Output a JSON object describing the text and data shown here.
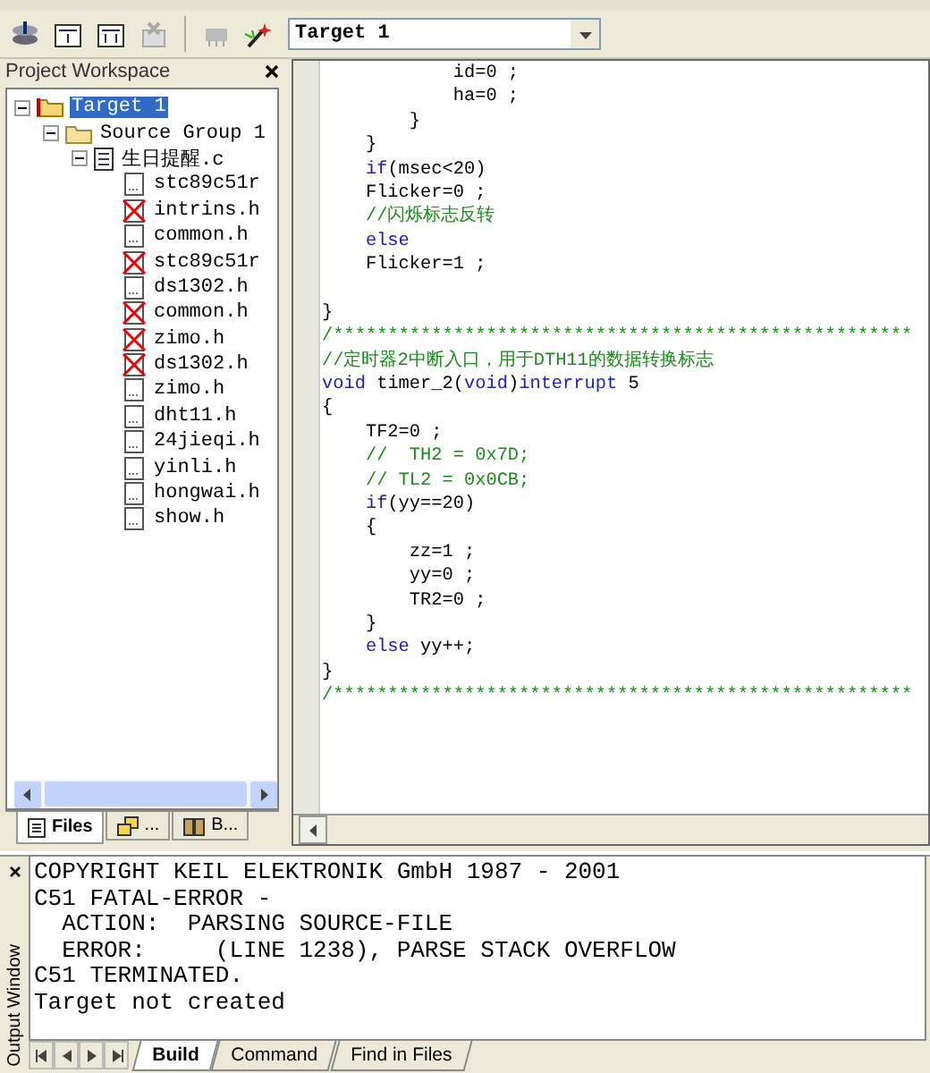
{
  "toolbar": {
    "target_select": {
      "value": "Target 1"
    }
  },
  "workspace": {
    "title": "Project Workspace",
    "tree": [
      {
        "label": "Target 1",
        "kind": "target",
        "selected": true,
        "expanded": true,
        "children": [
          {
            "label": "Source Group 1",
            "kind": "group",
            "selected": false,
            "expanded": true,
            "children": [
              {
                "label": "生日提醒.c",
                "kind": "source",
                "selected": false,
                "expanded": true,
                "children": [
                  {
                    "label": "stc89c51r",
                    "kind": "header",
                    "missing": false,
                    "selected": false
                  },
                  {
                    "label": "intrins.h",
                    "kind": "header",
                    "missing": true,
                    "selected": false
                  },
                  {
                    "label": "common.h",
                    "kind": "header",
                    "missing": false,
                    "selected": false
                  },
                  {
                    "label": "stc89c51r",
                    "kind": "header",
                    "missing": true,
                    "selected": false
                  },
                  {
                    "label": "ds1302.h",
                    "kind": "header",
                    "missing": false,
                    "selected": false
                  },
                  {
                    "label": "common.h",
                    "kind": "header",
                    "missing": true,
                    "selected": false
                  },
                  {
                    "label": "zimo.h",
                    "kind": "header",
                    "missing": true,
                    "selected": false
                  },
                  {
                    "label": "ds1302.h",
                    "kind": "header",
                    "missing": true,
                    "selected": false
                  },
                  {
                    "label": "zimo.h",
                    "kind": "header",
                    "missing": false,
                    "selected": false
                  },
                  {
                    "label": "dht11.h",
                    "kind": "header",
                    "missing": false,
                    "selected": false
                  },
                  {
                    "label": "24jieqi.h",
                    "kind": "header",
                    "missing": false,
                    "selected": false
                  },
                  {
                    "label": "yinli.h",
                    "kind": "header",
                    "missing": false,
                    "selected": false
                  },
                  {
                    "label": "hongwai.h",
                    "kind": "header",
                    "missing": false,
                    "selected": false
                  },
                  {
                    "label": "show.h",
                    "kind": "header",
                    "missing": false,
                    "selected": false
                  }
                ]
              }
            ]
          }
        ]
      }
    ],
    "tabs": [
      {
        "label": "Files",
        "kind": "files",
        "selected": true
      },
      {
        "label": "...",
        "kind": "regs",
        "selected": false
      },
      {
        "label": "B...",
        "kind": "books",
        "selected": false
      }
    ]
  },
  "editor": {
    "lines": [
      {
        "kind": "code",
        "parts": [
          {
            "text": "            id=0 ;",
            "kind": "plain"
          }
        ]
      },
      {
        "kind": "code",
        "parts": [
          {
            "text": "            ha=0 ;",
            "kind": "plain"
          }
        ]
      },
      {
        "kind": "code",
        "parts": [
          {
            "text": "        }",
            "kind": "plain"
          }
        ]
      },
      {
        "kind": "code",
        "parts": [
          {
            "text": "    }",
            "kind": "plain"
          }
        ]
      },
      {
        "kind": "code",
        "parts": [
          {
            "text": "    if",
            "kind": "keyword"
          },
          {
            "text": "(msec<20)",
            "kind": "plain"
          }
        ]
      },
      {
        "kind": "code",
        "parts": [
          {
            "text": "    Flicker=0 ;",
            "kind": "plain"
          }
        ]
      },
      {
        "kind": "code",
        "parts": [
          {
            "text": "    //闪烁标志反转",
            "kind": "comment"
          }
        ]
      },
      {
        "kind": "code",
        "parts": [
          {
            "text": "    else",
            "kind": "keyword"
          }
        ]
      },
      {
        "kind": "code",
        "parts": [
          {
            "text": "    Flicker=1 ;",
            "kind": "plain"
          }
        ]
      },
      {
        "kind": "blank"
      },
      {
        "kind": "code",
        "parts": [
          {
            "text": "}",
            "kind": "plain"
          }
        ]
      },
      {
        "kind": "code",
        "parts": [
          {
            "text": "/*****************************************************",
            "kind": "comment"
          }
        ]
      },
      {
        "kind": "code",
        "parts": [
          {
            "text": "//定时器2中断入口，用于DTH11的数据转换标志",
            "kind": "comment"
          }
        ]
      },
      {
        "kind": "code",
        "parts": [
          {
            "text": "void",
            "kind": "keyword"
          },
          {
            "text": " timer_2(",
            "kind": "plain"
          },
          {
            "text": "void",
            "kind": "keyword"
          },
          {
            "text": ")",
            "kind": "plain"
          },
          {
            "text": "interrupt",
            "kind": "keyword"
          },
          {
            "text": " 5",
            "kind": "plain"
          }
        ]
      },
      {
        "kind": "code",
        "parts": [
          {
            "text": "{",
            "kind": "plain"
          }
        ]
      },
      {
        "kind": "code",
        "parts": [
          {
            "text": "    TF2=0 ;",
            "kind": "plain"
          }
        ]
      },
      {
        "kind": "code",
        "parts": [
          {
            "text": "    //  TH2 = 0x7D;",
            "kind": "comment"
          }
        ]
      },
      {
        "kind": "code",
        "parts": [
          {
            "text": "    // TL2 = 0x0CB;",
            "kind": "comment"
          }
        ]
      },
      {
        "kind": "code",
        "parts": [
          {
            "text": "    if",
            "kind": "keyword"
          },
          {
            "text": "(yy==20)",
            "kind": "plain"
          }
        ]
      },
      {
        "kind": "code",
        "parts": [
          {
            "text": "    {",
            "kind": "plain"
          }
        ]
      },
      {
        "kind": "code",
        "parts": [
          {
            "text": "        zz=1 ;",
            "kind": "plain"
          }
        ]
      },
      {
        "kind": "code",
        "parts": [
          {
            "text": "        yy=0 ;",
            "kind": "plain"
          }
        ]
      },
      {
        "kind": "code",
        "parts": [
          {
            "text": "        TR2=0 ;",
            "kind": "plain"
          }
        ]
      },
      {
        "kind": "code",
        "parts": [
          {
            "text": "    }",
            "kind": "plain"
          }
        ]
      },
      {
        "kind": "code",
        "parts": [
          {
            "text": "    else",
            "kind": "keyword"
          },
          {
            "text": " yy++;",
            "kind": "plain"
          }
        ]
      },
      {
        "kind": "code",
        "parts": [
          {
            "text": "}",
            "kind": "plain"
          }
        ]
      },
      {
        "kind": "code",
        "parts": [
          {
            "text": "/*****************************************************",
            "kind": "comment"
          }
        ]
      }
    ]
  },
  "output": {
    "title": "Output Window",
    "lines": [
      "COPYRIGHT KEIL ELEKTRONIK GmbH 1987 - 2001",
      "C51 FATAL-ERROR -",
      "  ACTION:  PARSING SOURCE-FILE",
      "  ERROR:     (LINE 1238), PARSE STACK OVERFLOW",
      "C51 TERMINATED.",
      "Target not created"
    ],
    "tabs": [
      {
        "label": "Build",
        "selected": true
      },
      {
        "label": "Command",
        "selected": false
      },
      {
        "label": "Find in Files",
        "selected": false
      }
    ]
  }
}
